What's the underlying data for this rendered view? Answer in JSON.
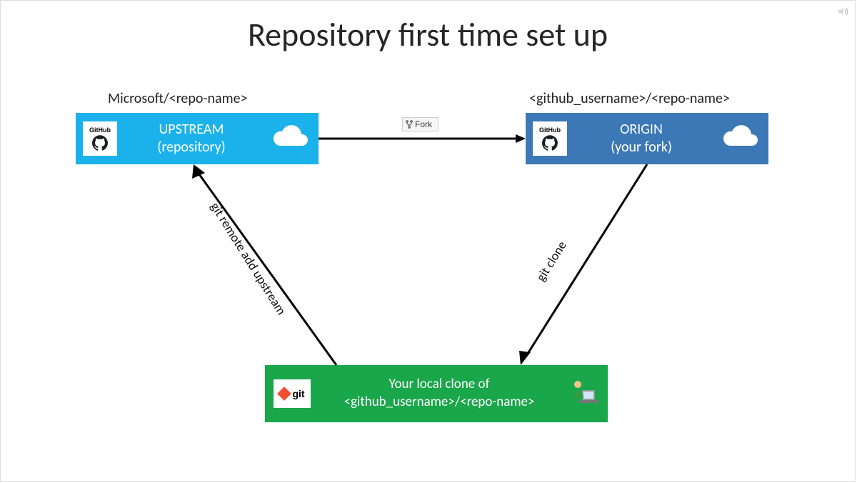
{
  "title": "Repository first time set up",
  "upstream": {
    "path": "Microsoft/<repo-name>",
    "line1": "UPSTREAM",
    "line2": "(repository)",
    "icon_label": "GitHub"
  },
  "origin": {
    "path": "<github_username>/<repo-name>",
    "line1": "ORIGIN",
    "line2": "(your fork)",
    "icon_label": "GitHub"
  },
  "local": {
    "line1": "Your local clone of",
    "line2": "<github_username>/<repo-name>",
    "icon_label": "git"
  },
  "fork_button": "Fork",
  "arrows": {
    "remote_add": "git remote add upstream",
    "clone": "git clone"
  },
  "icons": {
    "cloud": "cloud-icon",
    "github": "github-icon",
    "git": "git-icon",
    "user": "user-at-computer-icon",
    "fork": "fork-icon",
    "speaker": "speaker-icon"
  },
  "colors": {
    "upstream_bg": "#1bb2ec",
    "origin_bg": "#3b78b5",
    "local_bg": "#1aa64a"
  }
}
